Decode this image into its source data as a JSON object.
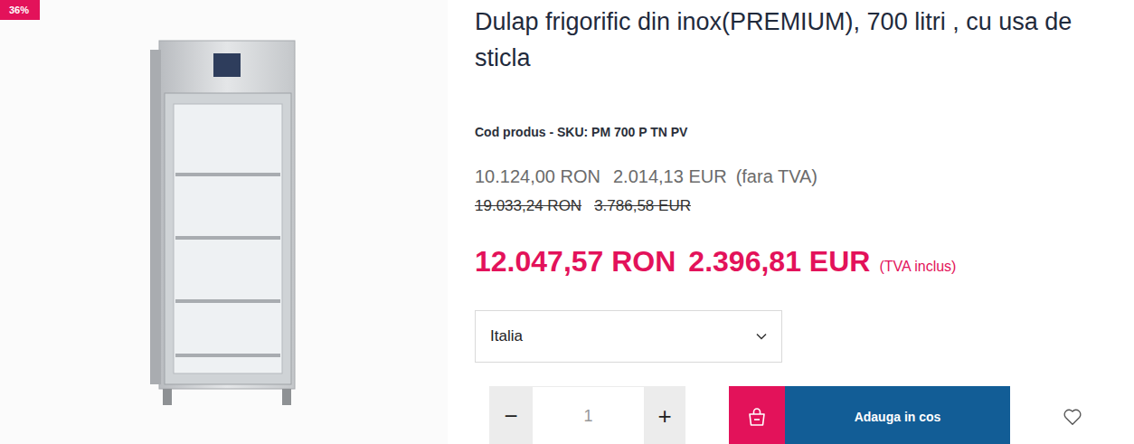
{
  "badge": "36%",
  "product": {
    "title": "Dulap frigorific din inox(PREMIUM), 700 litri , cu usa de sticla",
    "sku": "Cod produs - SKU: PM 700 P TN PV"
  },
  "prices": {
    "net": {
      "ron": "10.124,00 RON",
      "eur": "2.014,13 EUR",
      "note": "(fara TVA)"
    },
    "old": {
      "ron": "19.033,24 RON",
      "eur": "3.786,58 EUR",
      "struck": true
    },
    "gross": {
      "ron": "12.047,57 RON",
      "eur": "2.396,81 EUR",
      "note": "(TVA inclus)"
    }
  },
  "origin_select": {
    "value": "Italia",
    "expanded": false
  },
  "quantity": {
    "minus": "−",
    "value": "1",
    "plus": "+"
  },
  "cart_button": {
    "label": "Adauga in cos"
  },
  "wishlist": {
    "selected": false
  }
}
